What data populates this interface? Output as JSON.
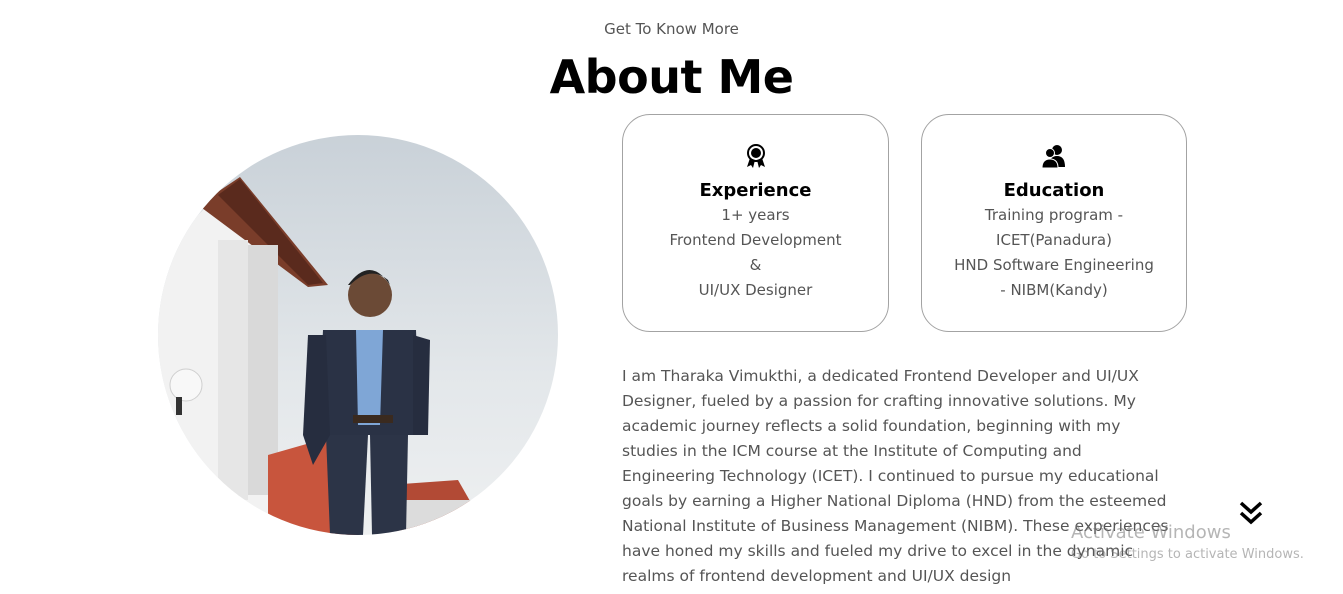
{
  "header": {
    "subtitle": "Get To Know More",
    "title": "About Me"
  },
  "profile_photo": {
    "description_icon": "profile-photo"
  },
  "cards": {
    "experience": {
      "icon": "award-icon",
      "title": "Experience",
      "lines": [
        "1+ years",
        "Frontend Development",
        "&",
        "UI/UX Designer"
      ]
    },
    "education": {
      "icon": "users-icon",
      "title": "Education",
      "lines": [
        "Training program -",
        "ICET(Panadura)",
        "HND Software Engineering",
        "- NIBM(Kandy)"
      ]
    }
  },
  "bio": {
    "lines": [
      "I am Tharaka Vimukthi, a dedicated Frontend Developer and UI/UX",
      "Designer, fueled by a passion for crafting innovative solutions. My",
      "academic journey reflects a solid foundation, beginning with my",
      "studies in the ICM course at the Institute of Computing and",
      "Engineering Technology (ICET). I continued to pursue my educational",
      "goals by earning a Higher National Diploma (HND) from the esteemed",
      "National Institute of Business Management (NIBM). These experiences",
      "have honed my skills and fueled my drive to excel in the dynamic",
      "realms of frontend development and UI/UX design"
    ]
  },
  "scroll": {
    "icon": "double-chevron-down-icon"
  },
  "watermark": {
    "line1": "Activate Windows",
    "line2": "Go to Settings to activate Windows."
  },
  "colors": {
    "title": "#000000",
    "text": "#555555",
    "card_border": "#a3a3a3"
  }
}
